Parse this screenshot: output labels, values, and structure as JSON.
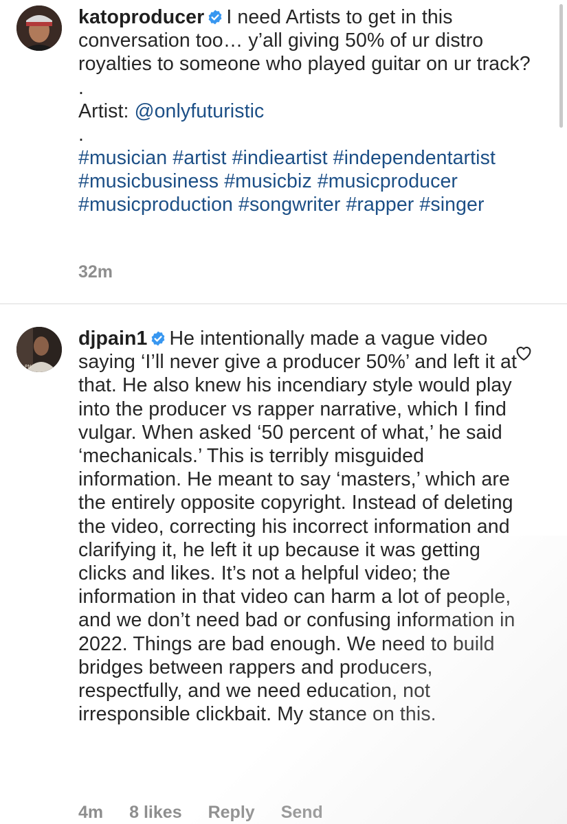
{
  "comments": [
    {
      "username": "katoproducer",
      "text_lead": "I need Artists to get in this conversation too… y’all giving 50% of ur distro royalties to someone who played guitar on ur track?",
      "dot1": ".",
      "artist_label": "Artist: ",
      "artist_handle": "@onlyfuturistic",
      "dot2": ".",
      "hashtags": [
        "#musician",
        "#artist",
        "#indieartist",
        "#independentartist",
        "#musicbusiness",
        "#musicbiz",
        "#musicproducer",
        "#musicproduction",
        "#songwriter",
        "#rapper",
        "#singer"
      ],
      "time": "32m"
    },
    {
      "username": "djpain1",
      "text": "He intentionally made a vague video saying ‘I’ll never give a producer 50%’ and left it at that. He also knew his incendiary style would play into the producer vs rapper narrative, which I find vulgar. When asked ‘50 percent of what,’ he said ‘mechanicals.’ This is terribly misguided information. He meant to say ‘masters,’ which are the entirely opposite copyright. Instead of deleting the video, correcting his incorrect information and clarifying it, he left it up because it was getting clicks and likes. It’s not a helpful video; the information in that video can harm a lot of people, and we don’t need bad or confusing information in 2022. Things are bad enough. We need to build bridges between rappers and producers, respectfully, and we need education, not irresponsible clickbait. My stance on this.",
      "time": "4m",
      "likes": "8 likes",
      "reply_label": "Reply",
      "send_label": "Send"
    }
  ],
  "colors": {
    "link": "#1c4f86",
    "meta": "#8e8e8e",
    "verified": "#3897f0"
  },
  "icons": {
    "verified": "verified-badge-icon",
    "like": "heart-outline-icon"
  }
}
